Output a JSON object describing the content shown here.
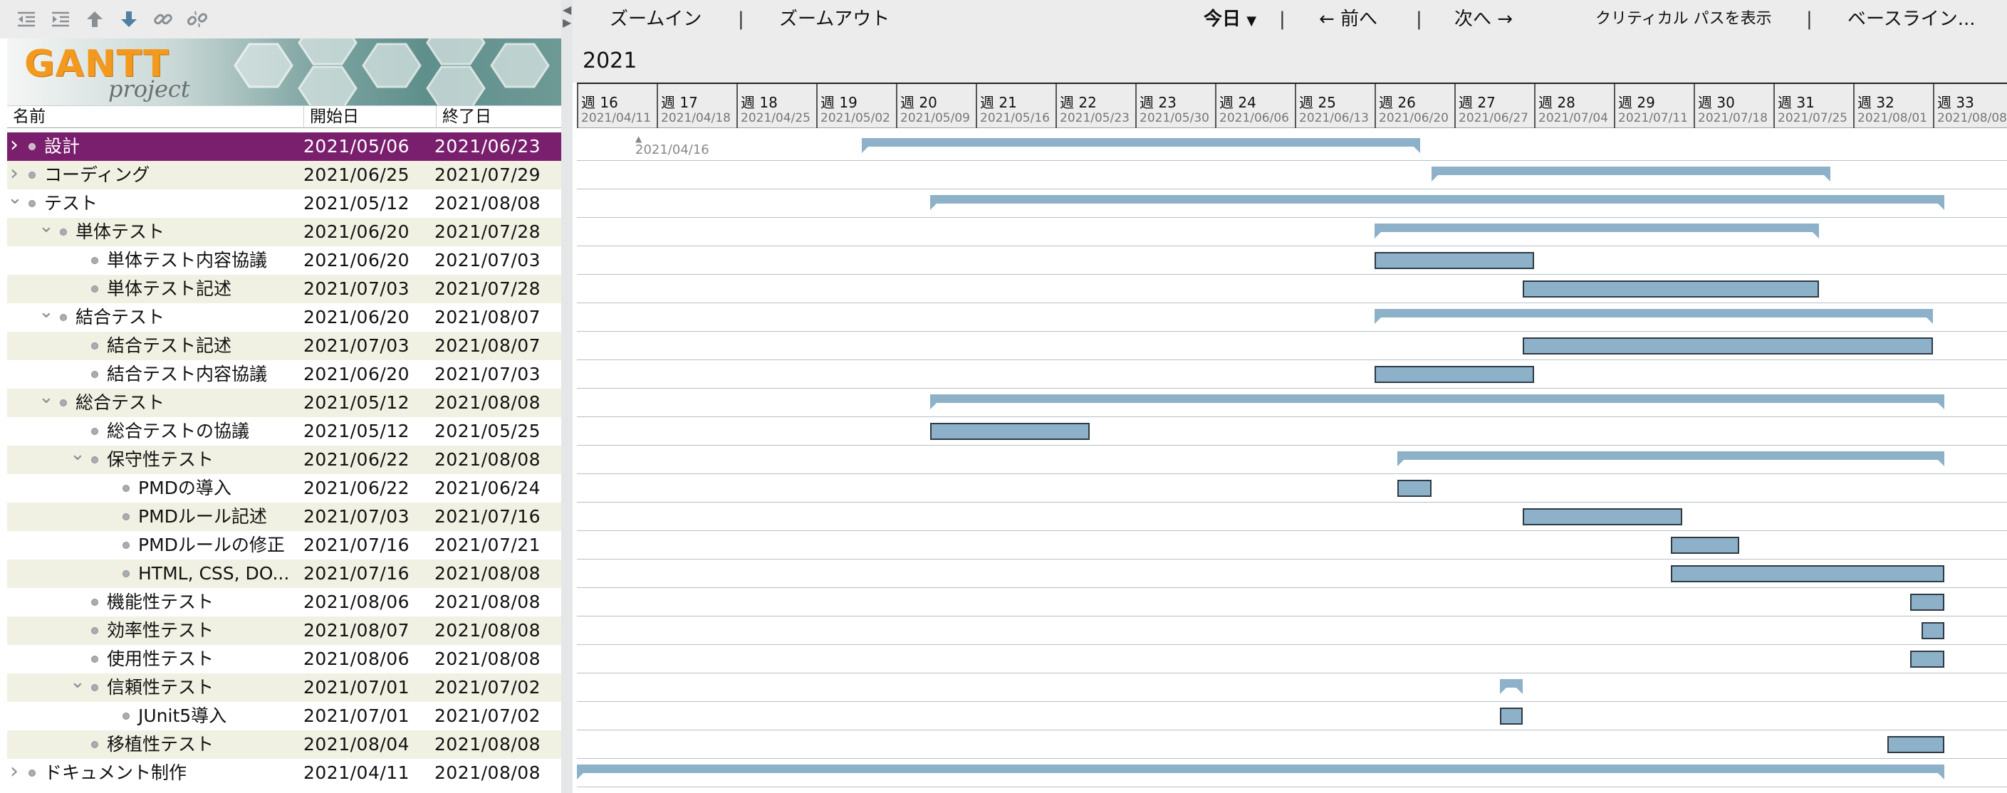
{
  "left_toolbar": {
    "buttons": [
      "outdent-icon",
      "indent-icon",
      "move-up-icon",
      "move-down-icon",
      "link-icon",
      "unlink-icon"
    ]
  },
  "logo": {
    "main": "GANTT",
    "sub": "project"
  },
  "tree_header": {
    "name": "名前",
    "start": "開始日",
    "end": "終了日"
  },
  "tasks": [
    {
      "name": "設計",
      "start": "2021/05/06",
      "end": "2021/06/23"
    },
    {
      "name": "コーディング",
      "start": "2021/06/25",
      "end": "2021/07/29"
    },
    {
      "name": "テスト",
      "start": "2021/05/12",
      "end": "2021/08/08"
    },
    {
      "name": "単体テスト",
      "start": "2021/06/20",
      "end": "2021/07/28"
    },
    {
      "name": "単体テスト内容協議",
      "start": "2021/06/20",
      "end": "2021/07/03"
    },
    {
      "name": "単体テスト記述",
      "start": "2021/07/03",
      "end": "2021/07/28"
    },
    {
      "name": "結合テスト",
      "start": "2021/06/20",
      "end": "2021/08/07"
    },
    {
      "name": "結合テスト記述",
      "start": "2021/07/03",
      "end": "2021/08/07"
    },
    {
      "name": "結合テスト内容協議",
      "start": "2021/06/20",
      "end": "2021/07/03"
    },
    {
      "name": "総合テスト",
      "start": "2021/05/12",
      "end": "2021/08/08"
    },
    {
      "name": "総合テストの協議",
      "start": "2021/05/12",
      "end": "2021/05/25"
    },
    {
      "name": "保守性テスト",
      "start": "2021/06/22",
      "end": "2021/08/08"
    },
    {
      "name": "PMDの導入",
      "start": "2021/06/22",
      "end": "2021/06/24"
    },
    {
      "name": "PMDルール記述",
      "start": "2021/07/03",
      "end": "2021/07/16"
    },
    {
      "name": "PMDルールの修正",
      "start": "2021/07/16",
      "end": "2021/07/21"
    },
    {
      "name": "HTML, CSS, DO...",
      "start": "2021/07/16",
      "end": "2021/08/08"
    },
    {
      "name": "機能性テスト",
      "start": "2021/08/06",
      "end": "2021/08/08"
    },
    {
      "name": "効率性テスト",
      "start": "2021/08/07",
      "end": "2021/08/08"
    },
    {
      "name": "使用性テスト",
      "start": "2021/08/06",
      "end": "2021/08/08"
    },
    {
      "name": "信頼性テスト",
      "start": "2021/07/01",
      "end": "2021/07/02"
    },
    {
      "name": "JUnit5導入",
      "start": "2021/07/01",
      "end": "2021/07/02"
    },
    {
      "name": "移植性テスト",
      "start": "2021/08/04",
      "end": "2021/08/08"
    },
    {
      "name": "ドキュメント制作",
      "start": "2021/04/11",
      "end": "2021/08/08"
    }
  ],
  "right_toolbar": {
    "zoom_in": "ズームイン",
    "zoom_out": "ズームアウト",
    "today": "今日",
    "prev": "← 前へ",
    "next": "次へ →",
    "critical_path": "クリティカル パスを表示",
    "baseline": "ベースライン...",
    "separator": "|"
  },
  "year": "2021",
  "weeks": [
    {
      "label": "週 16",
      "date": "2021/04/11"
    },
    {
      "label": "週 17",
      "date": "2021/04/18"
    },
    {
      "label": "週 18",
      "date": "2021/04/25"
    },
    {
      "label": "週 19",
      "date": "2021/05/02"
    },
    {
      "label": "週 20",
      "date": "2021/05/09"
    },
    {
      "label": "週 21",
      "date": "2021/05/16"
    },
    {
      "label": "週 22",
      "date": "2021/05/23"
    },
    {
      "label": "週 23",
      "date": "2021/05/30"
    },
    {
      "label": "週 24",
      "date": "2021/06/06"
    },
    {
      "label": "週 25",
      "date": "2021/06/13"
    },
    {
      "label": "週 26",
      "date": "2021/06/20"
    },
    {
      "label": "週 27",
      "date": "2021/06/27"
    },
    {
      "label": "週 28",
      "date": "2021/07/04"
    },
    {
      "label": "週 29",
      "date": "2021/07/11"
    },
    {
      "label": "週 30",
      "date": "2021/07/18"
    },
    {
      "label": "週 31",
      "date": "2021/07/25"
    },
    {
      "label": "週 32",
      "date": "2021/08/01"
    },
    {
      "label": "週 33",
      "date": "2021/08/08"
    }
  ],
  "today_marker": "2021/04/16",
  "colors": {
    "selected_row": "#7a1f6e",
    "alt_row": "#f1f1e3",
    "bar": "#8db1c9",
    "bar_border": "#2e3a44"
  }
}
